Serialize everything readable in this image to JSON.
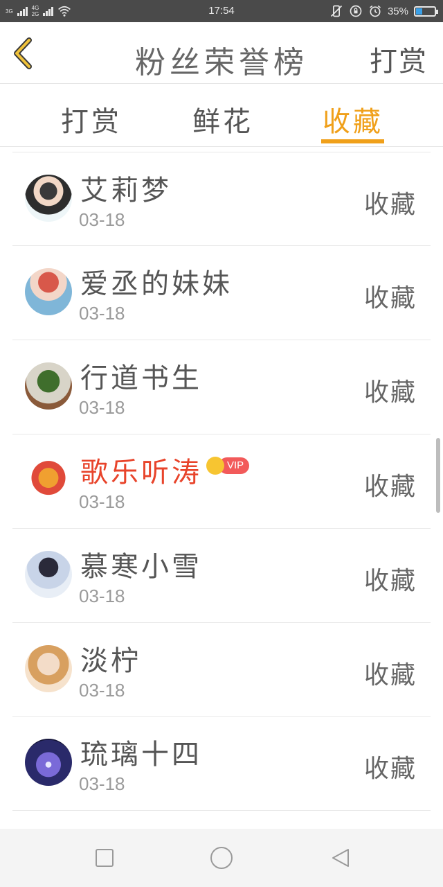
{
  "status_bar": {
    "net1": "3G",
    "net2_top": "4G",
    "net2_bottom": "2G",
    "time": "17:54",
    "battery": "35%",
    "battery_level": 0.35
  },
  "header": {
    "title": "粉丝荣誉榜",
    "action": "打赏"
  },
  "tabs": [
    {
      "label": "打赏",
      "active": false
    },
    {
      "label": "鲜花",
      "active": false
    },
    {
      "label": "收藏",
      "active": true
    }
  ],
  "fans": [
    {
      "name": "艾莉梦",
      "date": "03-18",
      "action": "收藏"
    },
    {
      "name": "爱丞的妹妹",
      "date": "03-18",
      "action": "收藏"
    },
    {
      "name": "行道书生",
      "date": "03-18",
      "action": "收藏"
    },
    {
      "name": "歌乐听涛",
      "date": "03-18",
      "action": "收藏",
      "vip": "VIP"
    },
    {
      "name": "慕寒小雪",
      "date": "03-18",
      "action": "收藏"
    },
    {
      "name": "淡柠",
      "date": "03-18",
      "action": "收藏"
    },
    {
      "name": "琉璃十四",
      "date": "03-18",
      "action": "收藏"
    }
  ],
  "colors": {
    "accent": "#f0a01a",
    "vip_name": "#e8442b",
    "vip_badge": "#f25a5a"
  },
  "icons": {
    "back": "chevron-left-icon",
    "nav_recent": "square-icon",
    "nav_home": "circle-icon",
    "nav_back": "triangle-back-icon"
  }
}
